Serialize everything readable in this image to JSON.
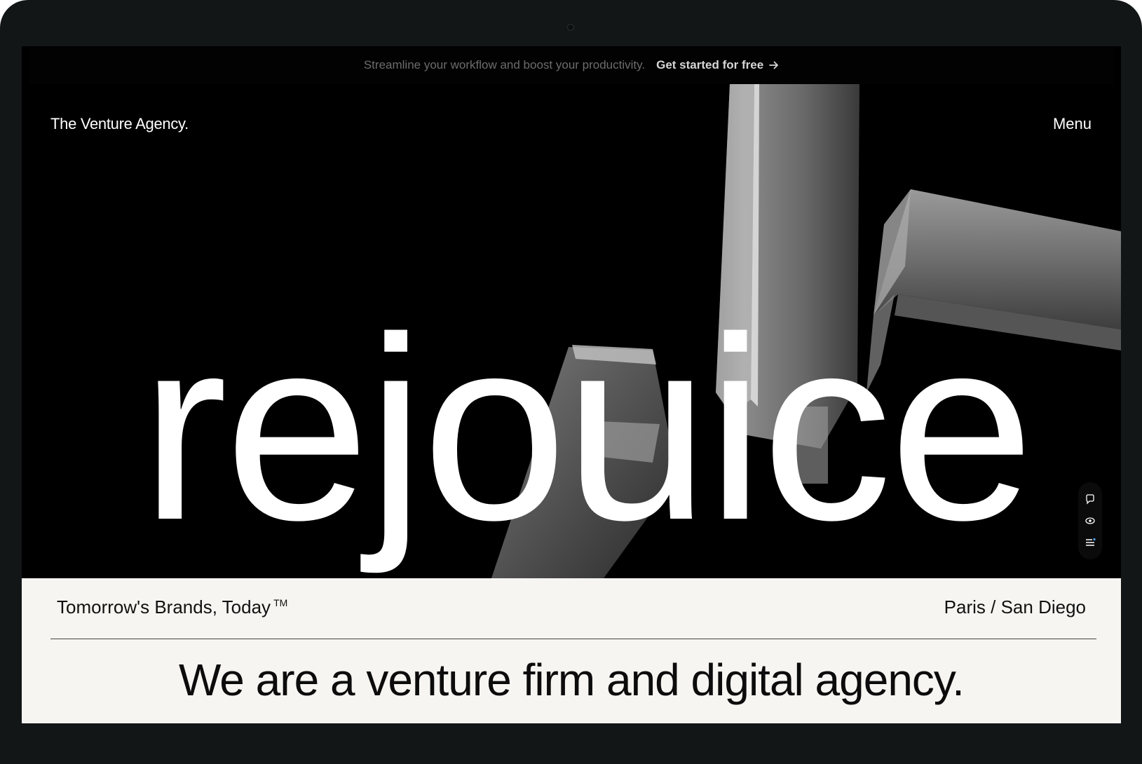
{
  "announcement": {
    "message": "Streamline your workflow and boost your productivity.",
    "cta_label": "Get started for free",
    "cta_icon": "arrow-right-icon"
  },
  "nav": {
    "logo": "The Venture Agency.",
    "menu_label": "Menu"
  },
  "hero": {
    "wordmark": "rejouice"
  },
  "side_tools": {
    "icons": [
      "chat-icon",
      "eye-icon",
      "list-icon"
    ]
  },
  "info_bar": {
    "tagline": "Tomorrow's Brands, Today",
    "tagline_mark": "TM",
    "locations": "Paris / San Diego"
  },
  "headline": "We are a venture firm and digital agency.",
  "colors": {
    "hero_background": "#000000",
    "section_background": "#f6f5f1",
    "text_light": "#ffffff",
    "text_dark": "#111111"
  }
}
